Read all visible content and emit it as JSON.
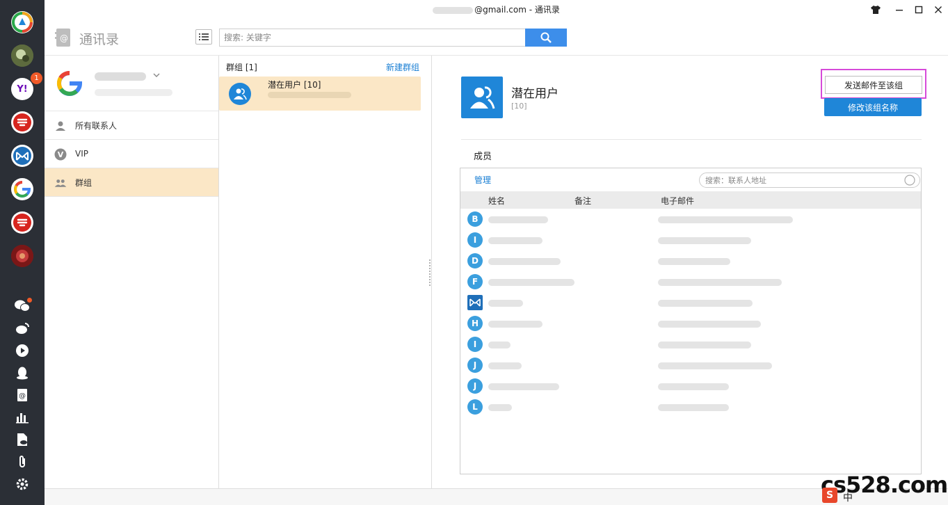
{
  "window": {
    "title_suffix": "@gmail.com - 通讯录"
  },
  "header": {
    "app_title": "通讯录",
    "search_placeholder": "搜索: 关键字"
  },
  "sidebar_accounts": [
    {
      "icon": "tile-app-icon"
    },
    {
      "icon": "avatar-photo-icon"
    },
    {
      "icon": "yahoo-icon",
      "label": "Y!",
      "badge": "1"
    },
    {
      "icon": "netease-163-icon"
    },
    {
      "icon": "mail-m-icon"
    },
    {
      "icon": "google-icon"
    },
    {
      "icon": "netease-163-icon"
    },
    {
      "icon": "avatar-red-icon"
    }
  ],
  "nav": {
    "items": [
      {
        "label": "所有联系人",
        "icon": "person-icon"
      },
      {
        "label": "VIP",
        "icon": "vip-icon"
      },
      {
        "label": "群组",
        "icon": "group-icon",
        "active": true
      }
    ]
  },
  "groups": {
    "header_label": "群组 [1]",
    "new_group_label": "新建群组",
    "items": [
      {
        "name": "潜在用户 [10]"
      }
    ]
  },
  "detail": {
    "group_title": "潜在用户",
    "group_count": "[10]",
    "send_button": "发送邮件至该组",
    "rename_button": "修改该组名称",
    "members_label": "成员",
    "manage_label": "管理",
    "search_placeholder": "搜索：联系人地址",
    "columns": [
      "姓名",
      "备注",
      "电子邮件"
    ],
    "rows": [
      {
        "initial": "B"
      },
      {
        "initial": "I"
      },
      {
        "initial": "D"
      },
      {
        "initial": "F"
      },
      {
        "initial": "M",
        "square": true
      },
      {
        "initial": "H"
      },
      {
        "initial": "I"
      },
      {
        "initial": "J"
      },
      {
        "initial": "J"
      },
      {
        "initial": "L"
      }
    ]
  },
  "watermark": {
    "text": "cs528.com",
    "badge": "S",
    "ime_char": "中"
  },
  "colors": {
    "accent": "#1f86d8",
    "highlight_row": "#fbe7c6",
    "rail": "#2b2f36",
    "callout": "#d64ad9"
  }
}
